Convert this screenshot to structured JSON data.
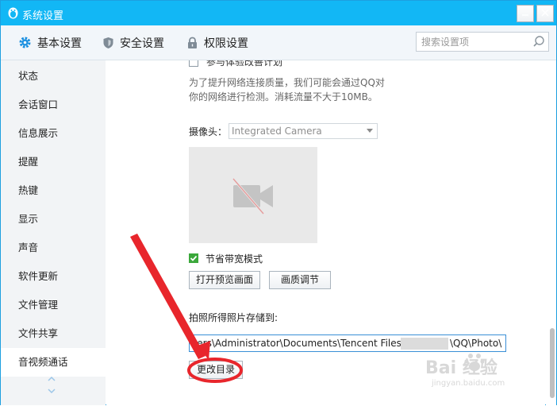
{
  "window": {
    "title": "系统设置"
  },
  "tabs": [
    {
      "label": "基本设置"
    },
    {
      "label": "安全设置"
    },
    {
      "label": "权限设置"
    }
  ],
  "search": {
    "placeholder": "搜索设置项"
  },
  "sidebar": {
    "items": [
      {
        "label": "状态"
      },
      {
        "label": "会话窗口"
      },
      {
        "label": "信息展示"
      },
      {
        "label": "提醒"
      },
      {
        "label": "热键"
      },
      {
        "label": "显示"
      },
      {
        "label": "声音"
      },
      {
        "label": "软件更新"
      },
      {
        "label": "文件管理"
      },
      {
        "label": "文件共享"
      },
      {
        "label": "音视频通话"
      }
    ],
    "active": "音视频通话"
  },
  "content": {
    "experience_plan_label": "参与体验改善计划",
    "network_hint_line1": "为了提升网络连接质量，我们可能会通过QQ对",
    "network_hint_line2": "你的网络进行检测。消耗流量不大于10MB。",
    "camera_label": "摄像头：",
    "camera_value": "Integrated Camera",
    "bandwidth_label": "节省带宽模式",
    "bandwidth_checked": true,
    "preview_button": "打开预览画面",
    "quality_button": "画质调节",
    "photo_path_label": "拍照所得照片存储到:",
    "photo_path_value_start": "sers\\Administrator\\Documents\\Tencent Files\\",
    "photo_path_value_end": "\\QQ\\Photo\\",
    "change_dir_button": "更改目录"
  },
  "watermark": {
    "text": "Bai 经验",
    "subtext": "jingyan.baidu.com"
  },
  "colors": {
    "titlebar": "#12b7f5",
    "annotation": "#e8262c",
    "check": "#3ba83b"
  }
}
